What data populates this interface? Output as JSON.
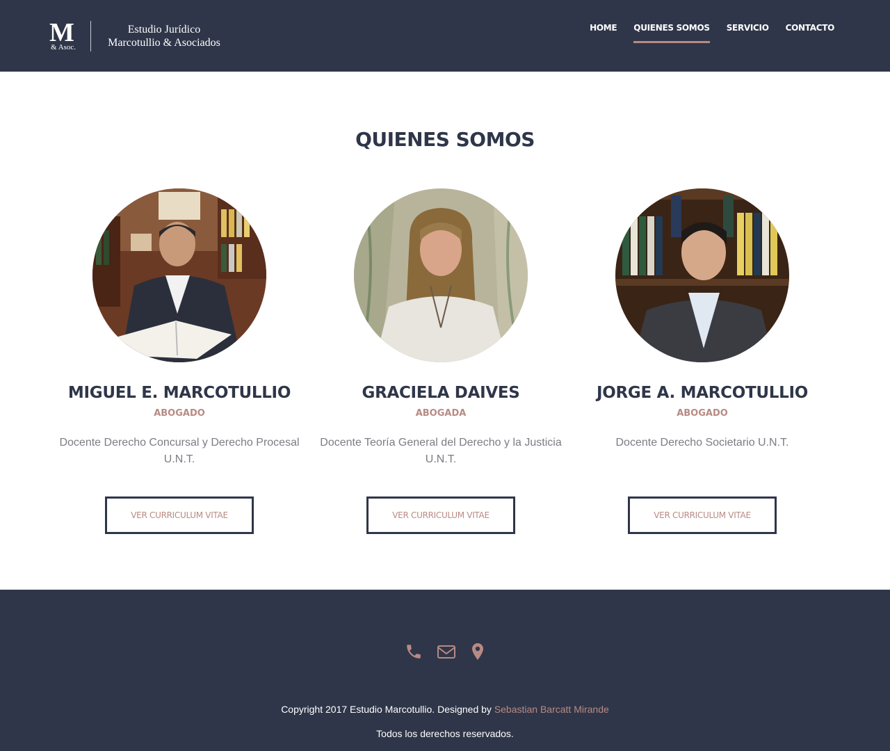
{
  "brand": {
    "mark": "M",
    "mark_sub": "& Asoc.",
    "line1": "Estudio Jurídico",
    "line2": "Marcotullio & Asociados"
  },
  "nav": {
    "items": [
      {
        "label": "HOME",
        "active": false
      },
      {
        "label": "QUIENES SOMOS",
        "active": true
      },
      {
        "label": "SERVICIO",
        "active": false
      },
      {
        "label": "CONTACTO",
        "active": false
      }
    ]
  },
  "main": {
    "title": "QUIENES SOMOS",
    "members": [
      {
        "name": "MIGUEL E. MARCOTULLIO",
        "role": "ABOGADO",
        "description": "Docente Derecho Concursal y Derecho Procesal U.N.T.",
        "button": "VER CURRICULUM VITAE"
      },
      {
        "name": "GRACIELA DAIVES",
        "role": "ABOGADA",
        "description": "Docente Teoría General del Derecho y la Justicia U.N.T.",
        "button": "VER CURRICULUM VITAE"
      },
      {
        "name": "JORGE A. MARCOTULLIO",
        "role": "ABOGADO",
        "description": "Docente Derecho Societario U.N.T.",
        "button": "VER CURRICULUM VITAE"
      }
    ]
  },
  "footer": {
    "icons": [
      "phone-icon",
      "envelope-icon",
      "map-marker-icon"
    ],
    "copyright_prefix": "Copyright 2017 Estudio Marcotullio. Designed by ",
    "designer": "Sebastian Barcatt Mirande",
    "rights": "Todos los derechos reservados."
  },
  "colors": {
    "navy": "#2f3649",
    "accent": "#b88a84",
    "muted_text": "#7b7d84"
  }
}
